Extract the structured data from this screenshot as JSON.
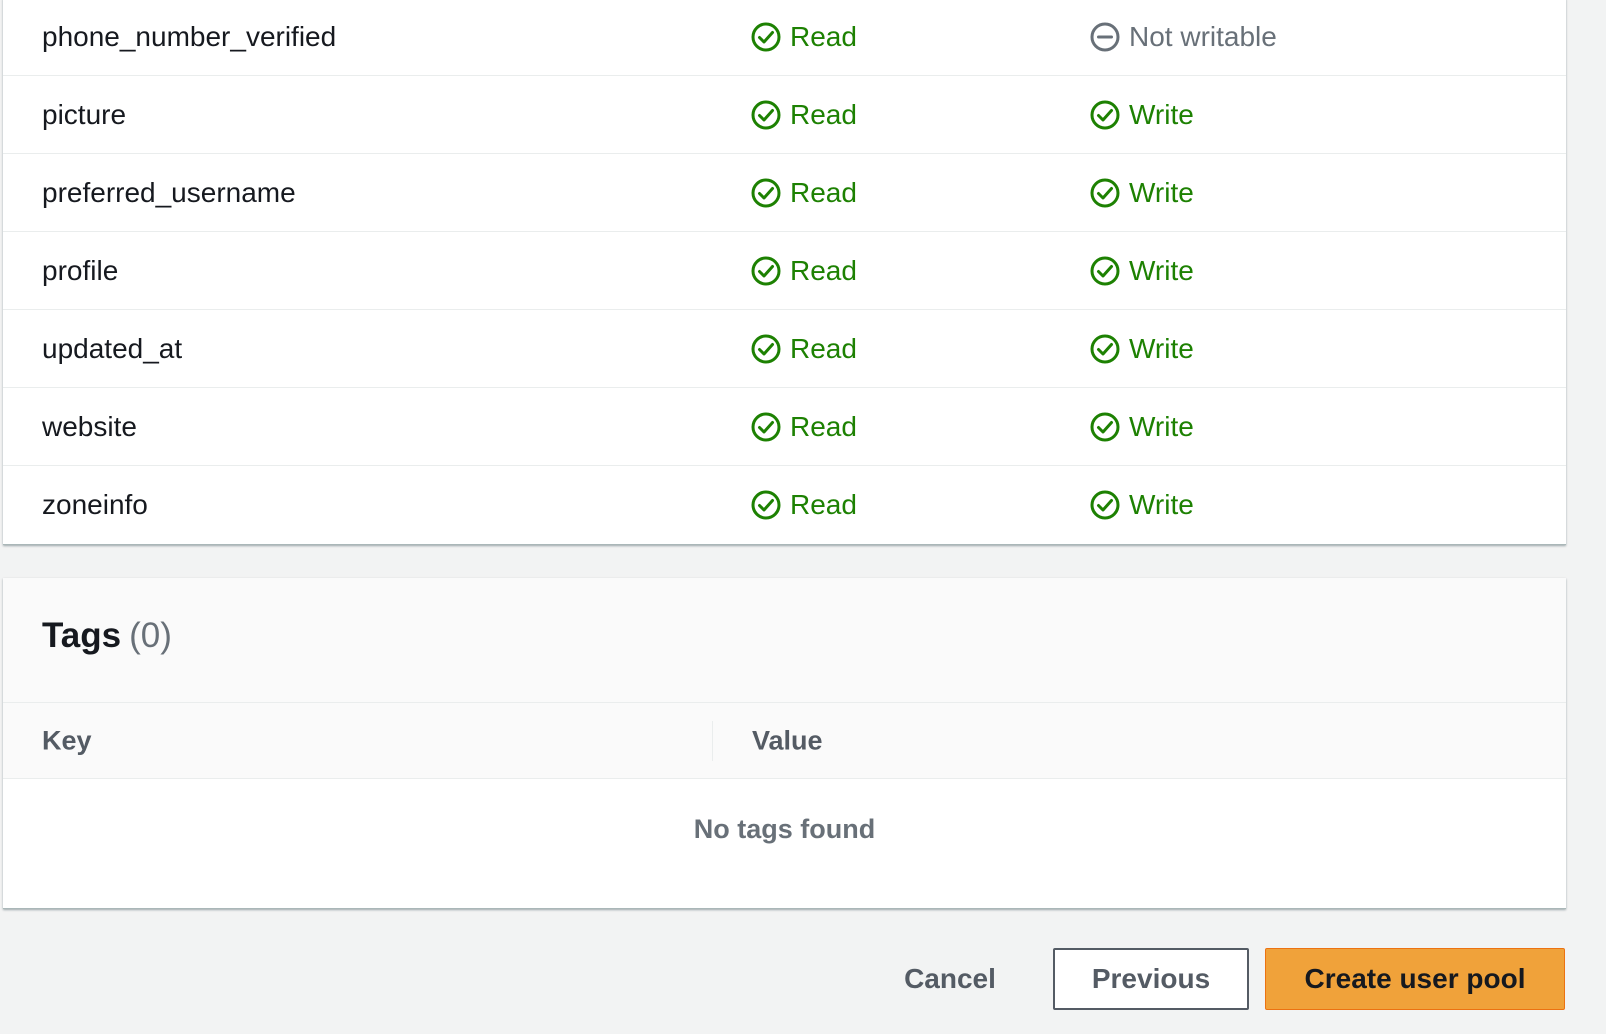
{
  "attributes": [
    {
      "name": "phone_number_verified",
      "read_label": "Read",
      "write_label": "Not writable",
      "writable": false
    },
    {
      "name": "picture",
      "read_label": "Read",
      "write_label": "Write",
      "writable": true
    },
    {
      "name": "preferred_username",
      "read_label": "Read",
      "write_label": "Write",
      "writable": true
    },
    {
      "name": "profile",
      "read_label": "Read",
      "write_label": "Write",
      "writable": true
    },
    {
      "name": "updated_at",
      "read_label": "Read",
      "write_label": "Write",
      "writable": true
    },
    {
      "name": "website",
      "read_label": "Read",
      "write_label": "Write",
      "writable": true
    },
    {
      "name": "zoneinfo",
      "read_label": "Read",
      "write_label": "Write",
      "writable": true
    }
  ],
  "tags": {
    "title": "Tags",
    "count": "(0)",
    "columns": {
      "key": "Key",
      "value": "Value"
    },
    "empty_message": "No tags found"
  },
  "footer": {
    "cancel_label": "Cancel",
    "previous_label": "Previous",
    "create_label": "Create user pool"
  },
  "colors": {
    "success": "#1d8102",
    "muted": "#687078",
    "primary_button": "#f0a23a"
  },
  "icons": {
    "success": "status-check-icon",
    "disabled": "status-minus-icon"
  }
}
